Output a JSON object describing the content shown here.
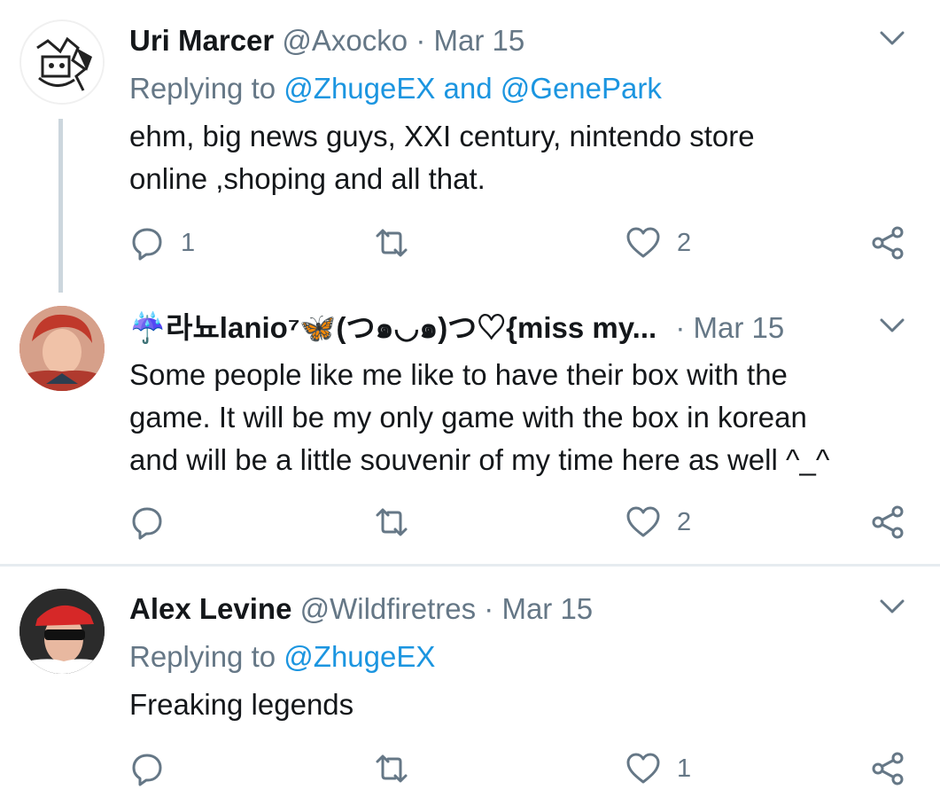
{
  "tweets": [
    {
      "name": "Uri Marcer",
      "handle": "@Axocko",
      "sep": "·",
      "date": "Mar 15",
      "replying_prefix": "Replying to",
      "replying_to": [
        "@ZhugeEX",
        "@GenePark"
      ],
      "replying_and": "and",
      "text_lines": [
        "ehm, big news guys, XXI century, nintendo store",
        "online ,shoping and all that."
      ],
      "reply_count": "1",
      "like_count": "2"
    },
    {
      "name": "☔라뇨lanio⁷🦋(つ๑◡๑)つ♡{miss my...",
      "sep": "·",
      "date": "Mar 15",
      "text_lines": [
        "Some people like me like to have their box with the",
        "game. It will be my only game with the box in korean",
        "and will be a little souvenir of my time here as well ^_^"
      ],
      "reply_count": "",
      "like_count": "2"
    },
    {
      "name": "Alex Levine",
      "handle": "@Wildfiretres",
      "sep": "·",
      "date": "Mar 15",
      "replying_prefix": "Replying to",
      "replying_to": [
        "@ZhugeEX"
      ],
      "text_lines": [
        "Freaking legends"
      ],
      "reply_count": "",
      "like_count": "1"
    }
  ],
  "icons": {
    "reply": "reply-icon",
    "retweet": "retweet-icon",
    "like": "heart-icon",
    "share": "share-icon",
    "more": "chevron-down-icon"
  },
  "colors": {
    "accent": "#1b95e0",
    "muted": "#657786",
    "text": "#14171a",
    "divider": "#e6ecf0",
    "thread_line": "#ccd6dd"
  }
}
